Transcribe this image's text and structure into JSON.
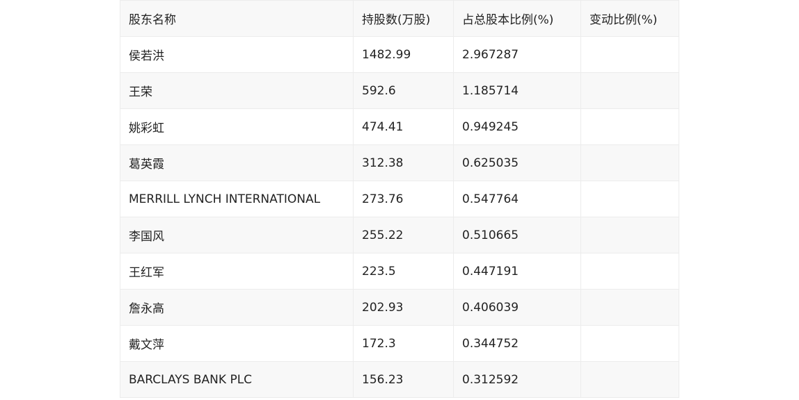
{
  "table": {
    "headers": [
      "股东名称",
      "持股数(万股)",
      "占总股本比例(%)",
      "变动比例(%)"
    ],
    "rows": [
      [
        "侯若洪",
        "1482.99",
        "2.967287",
        ""
      ],
      [
        "王荣",
        "592.6",
        "1.185714",
        ""
      ],
      [
        "姚彩虹",
        "474.41",
        "0.949245",
        ""
      ],
      [
        "葛英霞",
        "312.38",
        "0.625035",
        ""
      ],
      [
        "MERRILL LYNCH INTERNATIONAL",
        "273.76",
        "0.547764",
        ""
      ],
      [
        "李国风",
        "255.22",
        "0.510665",
        ""
      ],
      [
        "王红军",
        "223.5",
        "0.447191",
        ""
      ],
      [
        "詹永高",
        "202.93",
        "0.406039",
        ""
      ],
      [
        "戴文萍",
        "172.3",
        "0.344752",
        ""
      ],
      [
        "BARCLAYS BANK PLC",
        "156.23",
        "0.312592",
        ""
      ]
    ]
  }
}
